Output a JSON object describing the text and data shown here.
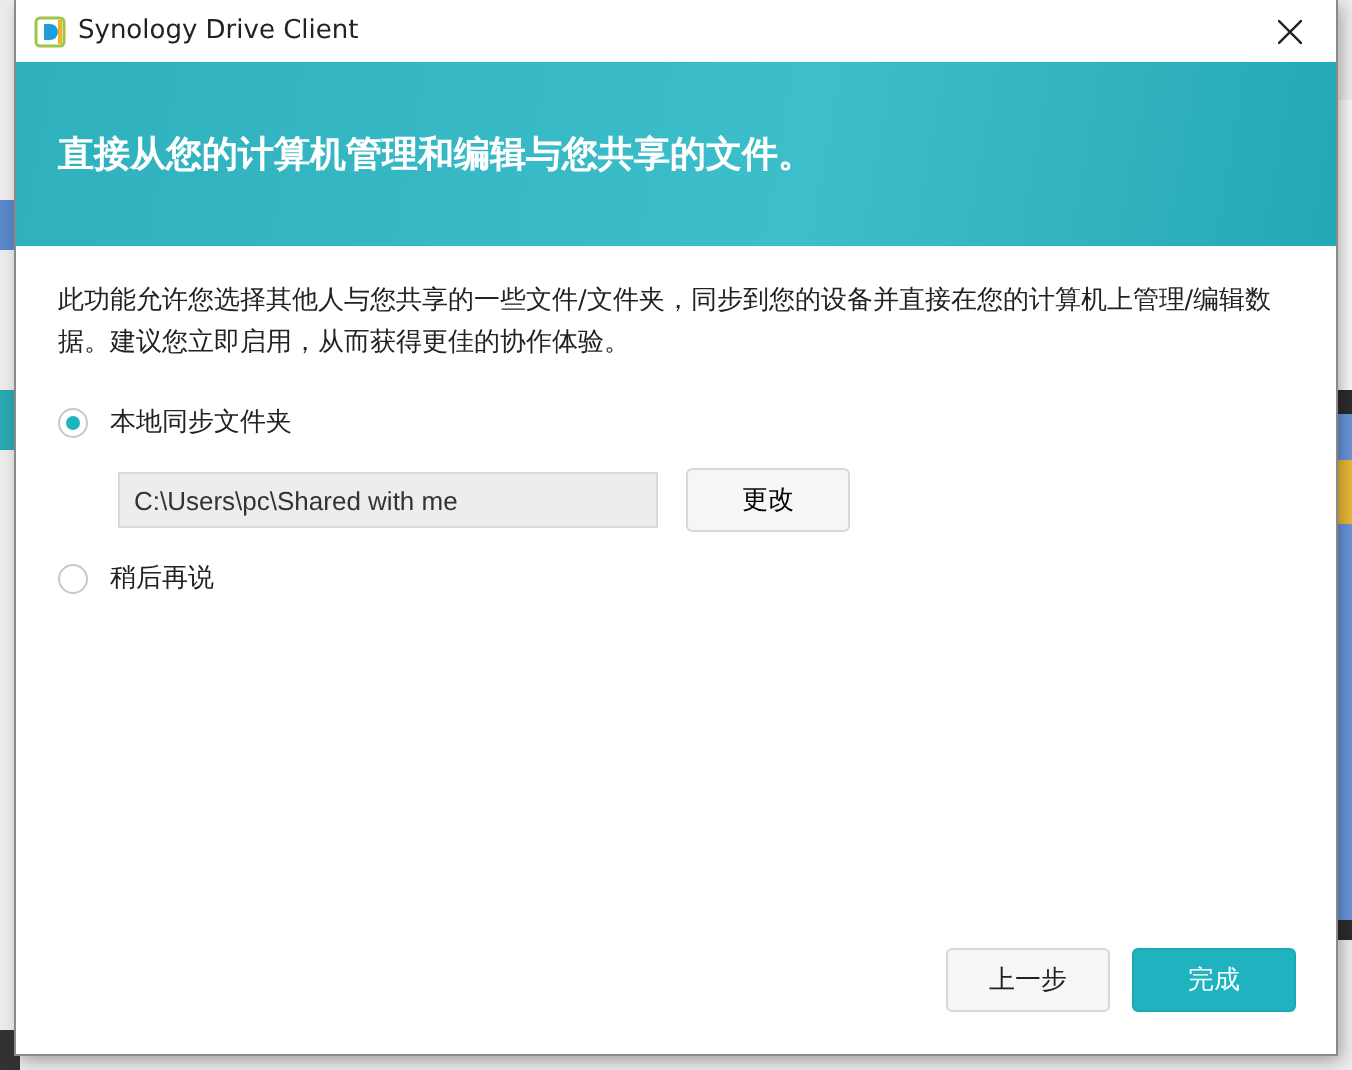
{
  "window": {
    "title": "Synology Drive Client"
  },
  "banner": {
    "heading": "直接从您的计算机管理和编辑与您共享的文件。"
  },
  "description": "此功能允许您选择其他人与您共享的一些文件/文件夹，同步到您的设备并直接在您的计算机上管理/编辑数据。建议您立即启用，从而获得更佳的协作体验。",
  "options": [
    {
      "label": "本地同步文件夹",
      "selected": true,
      "folder": {
        "value": "C:\\Users\\pc\\Shared with me",
        "button": "更改"
      }
    },
    {
      "label": "稍后再说",
      "selected": false
    }
  ],
  "buttons": [
    {
      "label": "上一步",
      "kind": "secondary"
    },
    {
      "label": "完成",
      "kind": "primary"
    }
  ]
}
